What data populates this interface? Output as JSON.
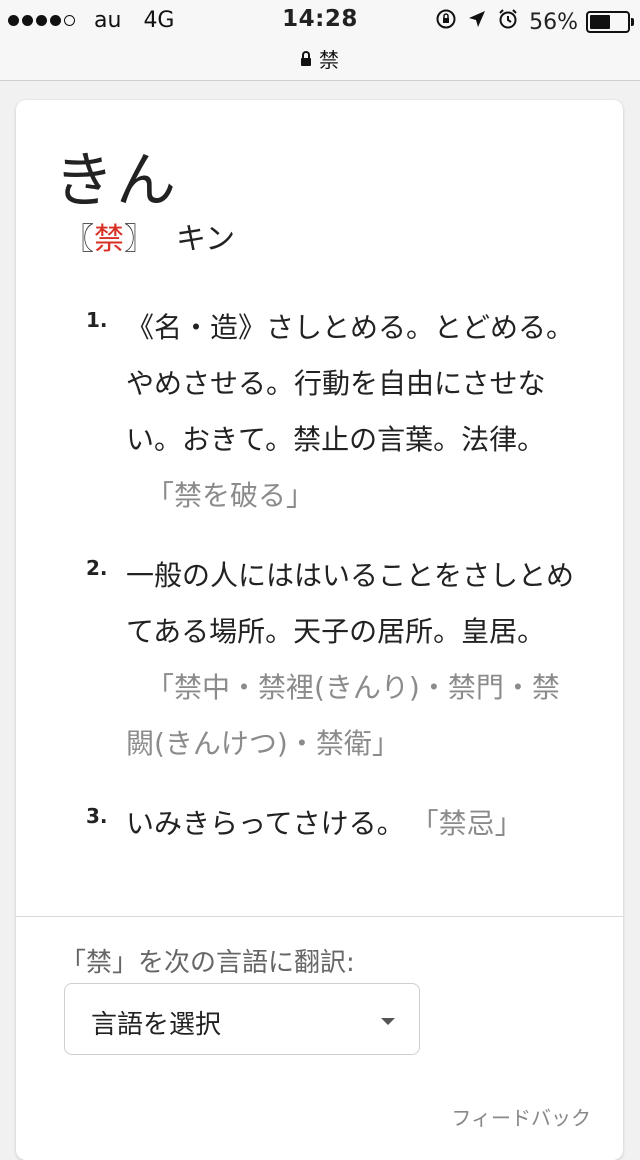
{
  "status_bar": {
    "carrier": "au",
    "network": "4G",
    "time": "14:28",
    "battery_percent": "56%",
    "battery_level": 0.56,
    "signal_bars_filled": 4,
    "signal_bars_total": 5,
    "icons": [
      "orientation-lock-icon",
      "location-arrow-icon",
      "alarm-icon",
      "battery-icon"
    ]
  },
  "address_bar": {
    "url_text": "禁",
    "secure_icon": "lock-icon"
  },
  "entry": {
    "headword": "きん",
    "kanji_open": "〖",
    "kanji": "禁",
    "kanji_close": "〗",
    "reading": "キン",
    "kanji_color": "#d93025",
    "definitions": [
      {
        "number": "1.",
        "text": "《名・造》さしとめる。とどめる。やめさせる。行動を自由にさせない。おきて。禁止の言葉。法律。",
        "example": "「禁を破る」"
      },
      {
        "number": "2.",
        "text": "一般の人にははいることをさしとめてある場所。天子の居所。皇居。",
        "example": "「禁中・禁裡(きんり)・禁門・禁闕(きんけつ)・禁衛」"
      },
      {
        "number": "3.",
        "text": "いみきらってさける。",
        "example": "「禁忌」"
      }
    ]
  },
  "translate": {
    "label": "「禁」を次の言語に翻訳:",
    "select_value": "言語を選択"
  },
  "feedback_label": "フィードバック"
}
